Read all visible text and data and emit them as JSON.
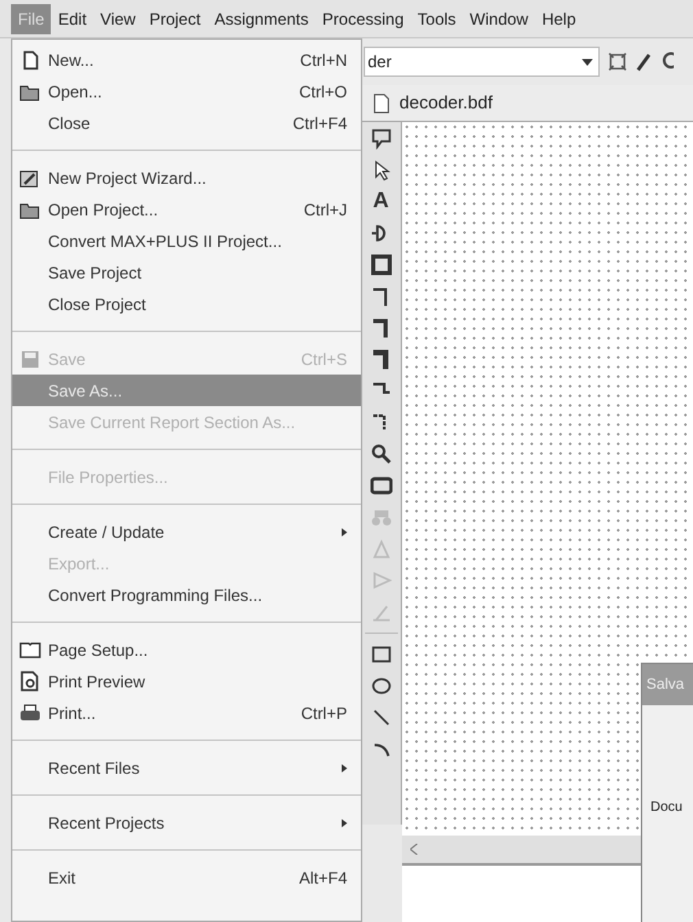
{
  "menubar": [
    {
      "label": "File",
      "selected": true
    },
    {
      "label": "Edit",
      "selected": false
    },
    {
      "label": "View",
      "selected": false
    },
    {
      "label": "Project",
      "selected": false
    },
    {
      "label": "Assignments",
      "selected": false
    },
    {
      "label": "Processing",
      "selected": false
    },
    {
      "label": "Tools",
      "selected": false
    },
    {
      "label": "Window",
      "selected": false
    },
    {
      "label": "Help",
      "selected": false
    }
  ],
  "file_menu": [
    {
      "kind": "item",
      "label": "New...",
      "shortcut": "Ctrl+N",
      "disabled": false,
      "selected": false
    },
    {
      "kind": "item",
      "label": "Open...",
      "shortcut": "Ctrl+O",
      "disabled": false,
      "selected": false
    },
    {
      "kind": "item",
      "label": "Close",
      "shortcut": "Ctrl+F4",
      "disabled": false,
      "selected": false
    },
    {
      "kind": "separator"
    },
    {
      "kind": "item",
      "label": "New Project Wizard...",
      "disabled": false,
      "selected": false
    },
    {
      "kind": "item",
      "label": "Open Project...",
      "shortcut": "Ctrl+J",
      "disabled": false,
      "selected": false
    },
    {
      "kind": "item",
      "label": "Convert MAX+PLUS II Project...",
      "disabled": false,
      "selected": false
    },
    {
      "kind": "item",
      "label": "Save Project",
      "disabled": false,
      "selected": false
    },
    {
      "kind": "item",
      "label": "Close Project",
      "disabled": false,
      "selected": false
    },
    {
      "kind": "separator"
    },
    {
      "kind": "item",
      "label": "Save",
      "shortcut": "Ctrl+S",
      "disabled": true,
      "selected": false
    },
    {
      "kind": "item",
      "label": "Save As...",
      "disabled": false,
      "selected": true
    },
    {
      "kind": "item",
      "label": "Save Current Report Section As...",
      "disabled": true,
      "selected": false
    },
    {
      "kind": "separator"
    },
    {
      "kind": "item",
      "label": "File Properties...",
      "disabled": true,
      "selected": false
    },
    {
      "kind": "separator"
    },
    {
      "kind": "submenu",
      "label": "Create / Update",
      "disabled": false,
      "selected": false
    },
    {
      "kind": "item",
      "label": "Export...",
      "disabled": true,
      "selected": false
    },
    {
      "kind": "item",
      "label": "Convert Programming Files...",
      "disabled": false,
      "selected": false
    },
    {
      "kind": "separator"
    },
    {
      "kind": "item",
      "label": "Page Setup...",
      "disabled": false,
      "selected": false
    },
    {
      "kind": "item",
      "label": "Print Preview",
      "disabled": false,
      "selected": false
    },
    {
      "kind": "item",
      "label": "Print...",
      "shortcut": "Ctrl+P",
      "disabled": false,
      "selected": false
    },
    {
      "kind": "separator"
    },
    {
      "kind": "submenu",
      "label": "Recent Files",
      "disabled": false,
      "selected": false
    },
    {
      "kind": "separator"
    },
    {
      "kind": "submenu",
      "label": "Recent Projects",
      "disabled": false,
      "selected": false
    },
    {
      "kind": "separator"
    },
    {
      "kind": "item",
      "label": "Exit",
      "shortcut": "Alt+F4",
      "disabled": false,
      "selected": false
    }
  ],
  "entity_combo": {
    "value": "der"
  },
  "document_tab": {
    "label": "decoder.bdf"
  },
  "tools": [
    {
      "kind": "callout",
      "disabled": false
    },
    {
      "kind": "pointer",
      "disabled": false
    },
    {
      "kind": "text",
      "label": "A",
      "disabled": false
    },
    {
      "kind": "symbol",
      "disabled": false
    },
    {
      "kind": "block",
      "disabled": false
    },
    {
      "kind": "wire",
      "disabled": false
    },
    {
      "kind": "bus",
      "disabled": false
    },
    {
      "kind": "conduit",
      "disabled": false
    },
    {
      "kind": "rubberband",
      "disabled": false
    },
    {
      "kind": "partial",
      "disabled": false
    },
    {
      "kind": "zoom",
      "disabled": false
    },
    {
      "kind": "screen",
      "disabled": false
    },
    {
      "kind": "binoculars",
      "disabled": true
    },
    {
      "kind": "flipx",
      "disabled": true
    },
    {
      "kind": "flipy",
      "disabled": true
    },
    {
      "kind": "rotate",
      "disabled": true
    },
    {
      "kind": "separator"
    },
    {
      "kind": "rectangle",
      "disabled": false
    },
    {
      "kind": "ellipse",
      "disabled": false
    },
    {
      "kind": "line",
      "disabled": false
    },
    {
      "kind": "arc",
      "disabled": false
    }
  ],
  "dialog": {
    "title": "Salva",
    "label": "Docu"
  }
}
